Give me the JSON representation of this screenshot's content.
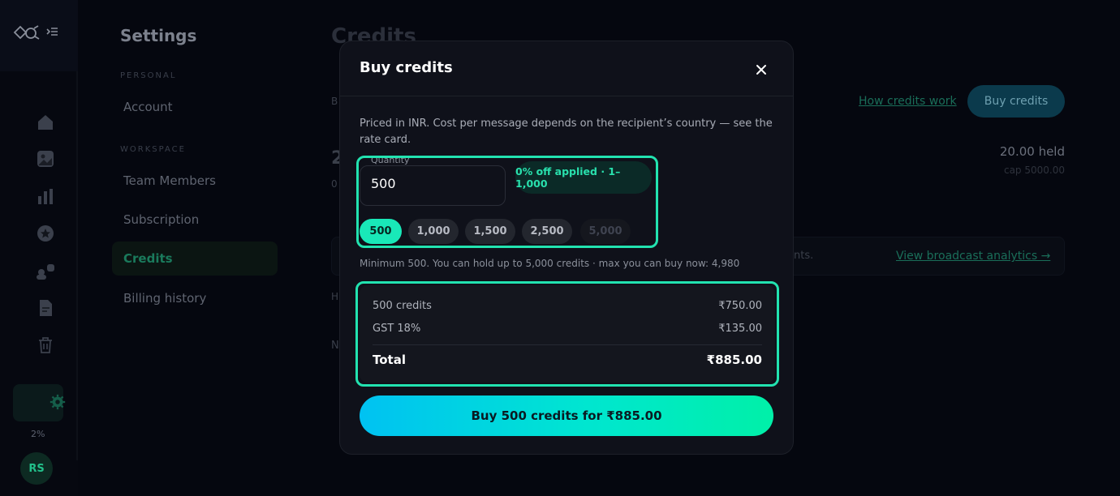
{
  "sidebar_rail": {
    "usage_pct": "2%",
    "avatar_initials": "RS",
    "icons": [
      "logo-icon",
      "collapse-icon",
      "home-icon",
      "image-icon",
      "bar-chart-icon",
      "star-icon",
      "users-icon",
      "document-icon",
      "trash-icon",
      "gear-icon"
    ]
  },
  "settings_nav": {
    "title": "Settings",
    "personal_label": "PERSONAL",
    "workspace_label": "WORKSPACE",
    "items": [
      {
        "label": "Account"
      },
      {
        "label": "Team Members"
      },
      {
        "label": "Subscription"
      },
      {
        "label": "Credits",
        "active": true
      },
      {
        "label": "Billing history"
      }
    ]
  },
  "background": {
    "heading": "Credits",
    "how_credits_work": "How credits work",
    "buy_credits_button": "Buy credits",
    "held": "20.00 held",
    "cap": "cap 5000.00",
    "view_analytics": "View broadcast analytics →",
    "fragments": {
      "b": "B",
      "big2": "2",
      "zero": "0",
      "nts": "nts.",
      "h": "H",
      "n": "N"
    }
  },
  "modal": {
    "title": "Buy credits",
    "description": "Priced in INR. Cost per message depends on the recipient’s country — see the rate card.",
    "quantity_label": "Quantity",
    "quantity_value": "500",
    "discount_badge": "0% off applied · 1–1,000",
    "chips": [
      {
        "label": "500",
        "state": "selected"
      },
      {
        "label": "1,000",
        "state": "normal"
      },
      {
        "label": "1,500",
        "state": "normal"
      },
      {
        "label": "2,500",
        "state": "normal"
      },
      {
        "label": "5,000",
        "state": "disabled"
      }
    ],
    "min_note": "Minimum 500. You can hold up to 5,000 credits · max you can buy now: 4,980",
    "summary": {
      "line1_label": "500 credits",
      "line1_value": "₹750.00",
      "line2_label": "GST 18%",
      "line2_value": "₹135.00",
      "total_label": "Total",
      "total_value": "₹885.00"
    },
    "cta_label": "Buy 500 credits for ₹885.00"
  },
  "colors": {
    "accent": "#19e8b8",
    "highlight_border": "#22e3b0",
    "cta_gradient_start": "#00c2f2",
    "cta_gradient_end": "#00f0a8",
    "modal_bg": "#0f111a"
  }
}
